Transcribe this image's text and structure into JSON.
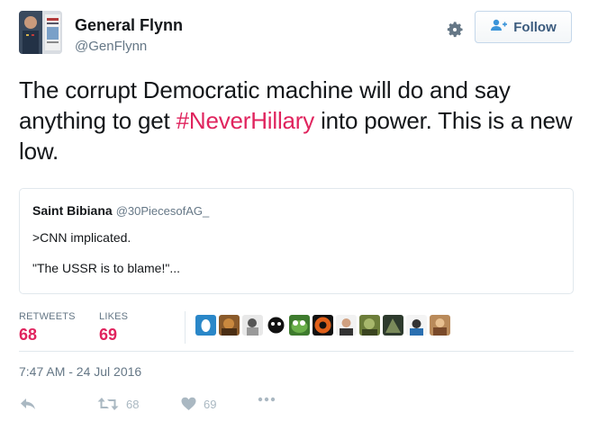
{
  "user": {
    "name": "General Flynn",
    "handle": "@GenFlynn"
  },
  "follow": {
    "label": "Follow"
  },
  "tweet": {
    "text_before": "The corrupt Democratic machine will do and say anything to get ",
    "hashtag": "#NeverHillary",
    "text_after": " into power. This is a new low."
  },
  "quote": {
    "name": "Saint Bibiana",
    "handle": "@30PiecesofAG_",
    "line1": ">CNN implicated.",
    "line2": "\"The USSR is to blame!\"..."
  },
  "stats": {
    "retweets_label": "RETWEETS",
    "retweets": "68",
    "likes_label": "LIKES",
    "likes": "69"
  },
  "timestamp": "7:47 AM - 24 Jul 2016",
  "actions": {
    "retweet_count": "68",
    "like_count": "69"
  },
  "colors": {
    "hashtag": "#e0245e",
    "stat_value": "#e0245e",
    "muted": "#657786",
    "follow_text": "#3b5b7e"
  },
  "icons": [
    "settings-gear-icon",
    "follow-person-plus-icon",
    "reply-icon",
    "retweet-icon",
    "like-heart-icon",
    "more-icon"
  ]
}
